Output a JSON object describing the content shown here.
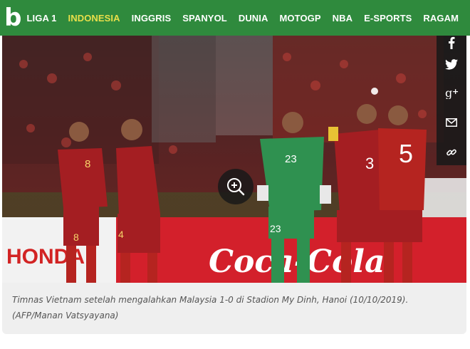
{
  "brand": {
    "logo_letter": "b",
    "color": "#2f8a3d",
    "active_color": "#e8df4a"
  },
  "nav": {
    "items": [
      {
        "label": "LIGA 1",
        "active": false
      },
      {
        "label": "INDONESIA",
        "active": true
      },
      {
        "label": "INGGRIS",
        "active": false
      },
      {
        "label": "SPANYOL",
        "active": false
      },
      {
        "label": "DUNIA",
        "active": false
      },
      {
        "label": "MOTOGP",
        "active": false
      },
      {
        "label": "NBA",
        "active": false
      },
      {
        "label": "E-SPORTS",
        "active": false
      },
      {
        "label": "RAGAM",
        "active": false
      }
    ]
  },
  "photo": {
    "jersey_numbers": [
      "8",
      "4",
      "23",
      "5",
      "23",
      "8"
    ],
    "banner_text": "Coca-Cola",
    "left_banner_text": "HONDA"
  },
  "share": {
    "icons": [
      "facebook-icon",
      "twitter-icon",
      "google-plus-icon",
      "email-icon",
      "link-icon"
    ]
  },
  "caption": {
    "text": "Timnas Vietnam setelah mengalahkan Malaysia 1-0 di Stadion My Dinh, Hanoi (10/10/2019). (AFP/Manan Vatsyayana)"
  }
}
